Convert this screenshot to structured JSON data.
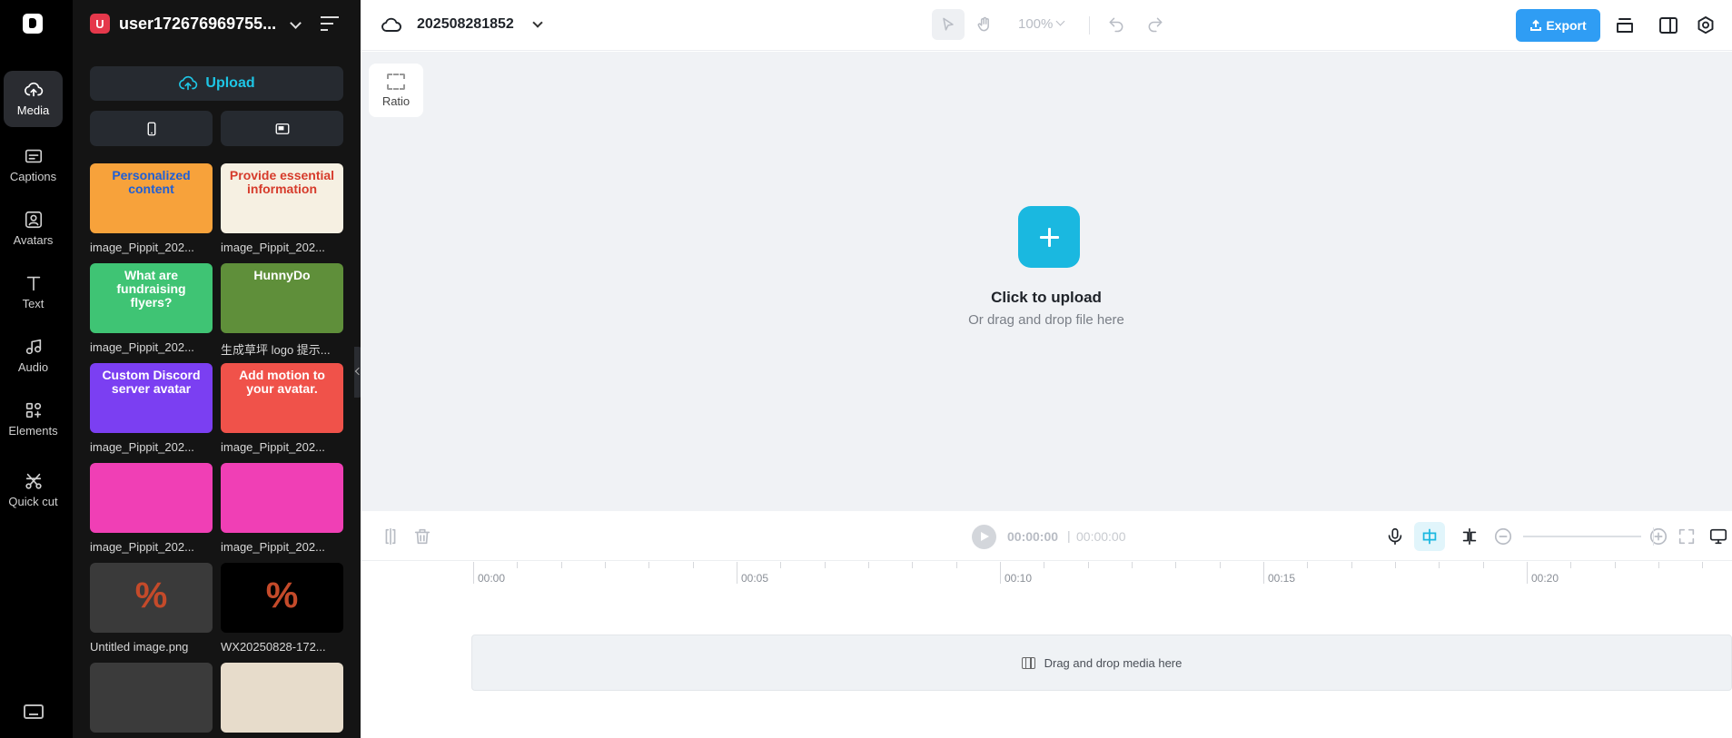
{
  "rail": {
    "items": [
      {
        "label": "Media",
        "icon": "cloud-upload-icon"
      },
      {
        "label": "Captions",
        "icon": "captions-icon"
      },
      {
        "label": "Avatars",
        "icon": "avatar-icon"
      },
      {
        "label": "Text",
        "icon": "text-icon"
      },
      {
        "label": "Audio",
        "icon": "music-note-icon"
      },
      {
        "label": "Elements",
        "icon": "elements-icon"
      },
      {
        "label": "Quick cut",
        "icon": "scissors-icon"
      }
    ],
    "active": "Media"
  },
  "panel": {
    "account_initial": "U",
    "account_name": "user172676969755...",
    "upload_label": "Upload",
    "media": [
      {
        "label": "image_Pippit_202...",
        "thumb_text": "Personalized content",
        "bg": "#f7a23b",
        "fg": "#1f5fd6"
      },
      {
        "label": "image_Pippit_202...",
        "thumb_text": "Provide essential information",
        "bg": "#f6f0e2",
        "fg": "#d63b2b"
      },
      {
        "label": "image_Pippit_202...",
        "thumb_text": "What are fundraising flyers?",
        "bg": "#3fc474",
        "fg": "#ffffff"
      },
      {
        "label": "生成草坪 logo 提示...",
        "thumb_text": "HunnyDo",
        "bg": "#5f8f3a",
        "fg": "#ffffff"
      },
      {
        "label": "image_Pippit_202...",
        "thumb_text": "Custom Discord server avatar",
        "bg": "#7b3ff2",
        "fg": "#ffffff"
      },
      {
        "label": "image_Pippit_202...",
        "thumb_text": "Add motion to your avatar.",
        "bg": "#f0524a",
        "fg": "#ffffff"
      },
      {
        "label": "image_Pippit_202...",
        "thumb_text": "",
        "bg": "#f03fb5",
        "fg": "#ffffff"
      },
      {
        "label": "image_Pippit_202...",
        "thumb_text": "",
        "bg": "#f03fb5",
        "fg": "#ffffff"
      },
      {
        "label": "Untitled image.png",
        "thumb_text": "%",
        "bg": "#3a3a3a",
        "fg": "#c44a2a"
      },
      {
        "label": "WX20250828-172...",
        "thumb_text": "%",
        "bg": "#000000",
        "fg": "#c44a2a"
      },
      {
        "label": "",
        "thumb_text": "",
        "bg": "#3b3b3b",
        "fg": "#ffffff"
      },
      {
        "label": "",
        "thumb_text": "",
        "bg": "#e7dccb",
        "fg": "#ffffff"
      }
    ]
  },
  "topbar": {
    "project_name": "202508281852",
    "zoom": "100%",
    "export_label": "Export",
    "accent": "#2f9df4"
  },
  "canvas": {
    "ratio_label": "Ratio",
    "upload_title": "Click to upload",
    "upload_sub": "Or drag and drop file here"
  },
  "timeline": {
    "current_time": "00:00:00",
    "separator": "|",
    "total_time": "00:00:00",
    "ticks": [
      "00:00",
      "00:05",
      "00:10",
      "00:15",
      "00:20"
    ],
    "drop_label": "Drag and drop media here"
  }
}
